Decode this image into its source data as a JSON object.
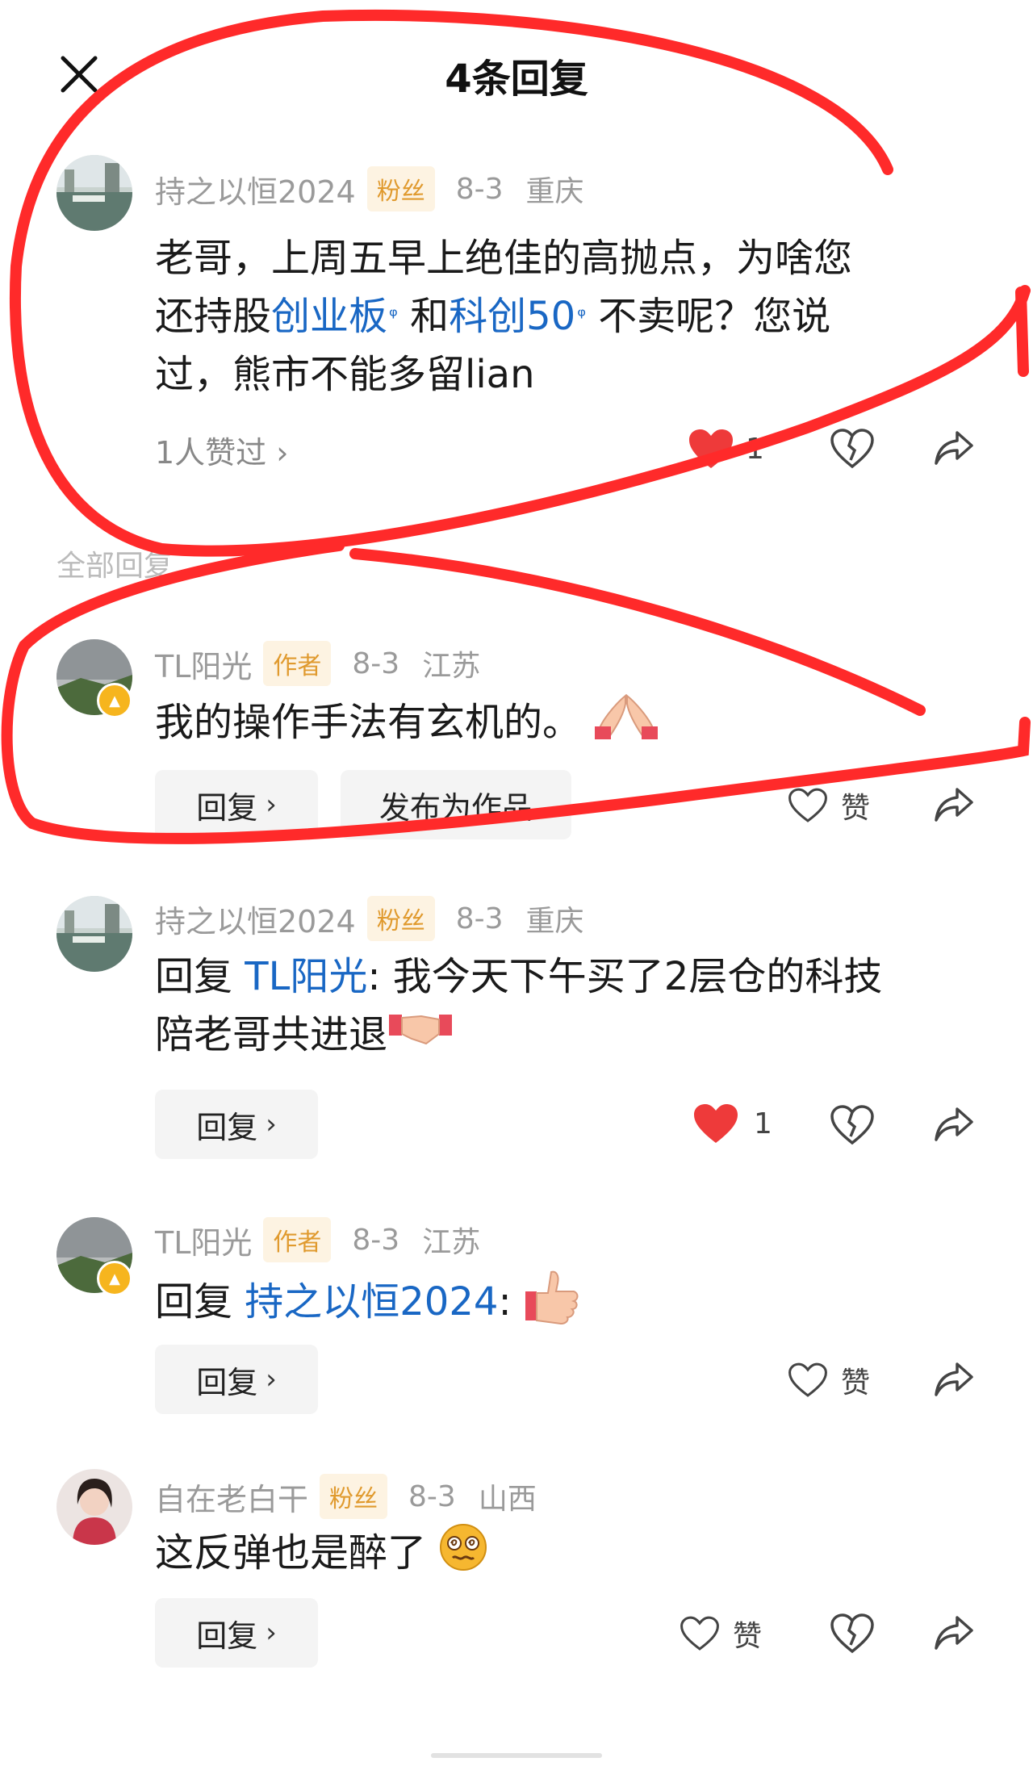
{
  "header": {
    "title": "4条回复"
  },
  "main_comment": {
    "username": "持之以恒2024",
    "tag": "粉丝",
    "date": "8-3",
    "location": "重庆",
    "text_part1": "老哥，上周五早上绝佳的高抛点，为啥您",
    "text_part2": "还持股",
    "link1": "创业板",
    "text_part3": " 和",
    "link2": "科创50",
    "text_part4": " 不卖呢？您说",
    "text_part5": "过，熊市不能多留lian",
    "likers": "1人赞过",
    "like_count": "1"
  },
  "section_label": "全部回复",
  "replies": [
    {
      "username": "TL阳光",
      "tag": "作者",
      "date": "8-3",
      "location": "江苏",
      "text": "我的操作手法有玄机的。",
      "reply_label": "回复",
      "publish_label": "发布为作品",
      "like_label": "赞"
    },
    {
      "username": "持之以恒2024",
      "tag": "粉丝",
      "date": "8-3",
      "location": "重庆",
      "prefix": "回复 ",
      "mention": "TL阳光",
      "text_line1": ": 我今天下午买了2层仓的科技",
      "text_line2": "陪老哥共进退",
      "reply_label": "回复",
      "like_count": "1"
    },
    {
      "username": "TL阳光",
      "tag": "作者",
      "date": "8-3",
      "location": "江苏",
      "prefix": "回复 ",
      "mention": "持之以恒2024",
      "text": ":",
      "reply_label": "回复",
      "like_label": "赞"
    },
    {
      "username": "自在老白干",
      "tag": "粉丝",
      "date": "8-3",
      "location": "山西",
      "text": "这反弹也是醉了",
      "reply_label": "回复",
      "like_label": "赞"
    }
  ],
  "colors": {
    "link": "#1967c4",
    "tag_text": "#e09a2e",
    "heart": "#ee3a3a",
    "scribble": "#ff2a2a"
  }
}
